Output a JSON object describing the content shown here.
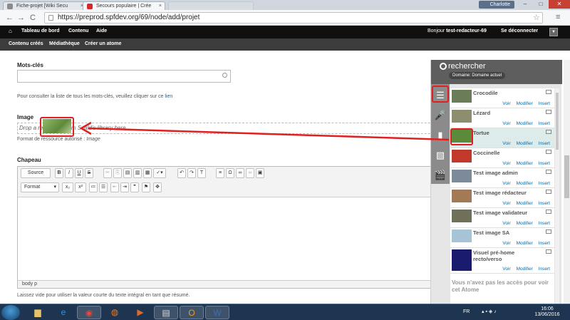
{
  "browser": {
    "tabs": [
      {
        "title": "Fiche-projet [Wiki Secu",
        "active": false
      },
      {
        "title": "Secours populaire | Crée",
        "active": true
      },
      {
        "title": "",
        "active": false
      }
    ],
    "user": "Charlotte",
    "url": "https://preprod.spfdev.org/69/node/add/projet"
  },
  "toolbar": {
    "home_icon": "home-icon",
    "items": [
      "Tableau de bord",
      "Contenu",
      "Aide"
    ],
    "greeting": "Bonjour",
    "username": "test-redacteur-69",
    "logout": "Se déconnecter",
    "secondary": [
      "Contenu créés",
      "Médiathèque",
      "Créer un atome"
    ]
  },
  "form": {
    "keywords_label": "Mots-clés",
    "keywords_help": "Pour consulter la liste de tous les mots-clés, veuillez cliquer sur ce",
    "keywords_link": "lien",
    "image_label": "Image",
    "image_dropzone": "Drop a ressource from Scald's library here.",
    "image_format_prefix": "Format de ressource autorisé :",
    "image_format": "Image",
    "chapeau_label": "Chapeau",
    "chapeau_help": "Laissez vide pour utiliser la valeur courte du texte intégral en tant que résumé.",
    "editor_source": "Source",
    "editor_format": "Format",
    "editor_path": "body  p"
  },
  "panel": {
    "search_label": "rechercher",
    "domain": "Domaine: Domaine actuel",
    "actions": [
      "Voir",
      "Modifier",
      "Insert"
    ],
    "items": [
      {
        "title": "Crocodile",
        "color": "#6b7d58"
      },
      {
        "title": "Lézard",
        "color": "#8d8d70"
      },
      {
        "title": "Tortue",
        "color": "#5a8a3a"
      },
      {
        "title": "Coccinelle",
        "color": "#c0392b"
      },
      {
        "title": "Test image admin",
        "color": "#7d8a9a"
      },
      {
        "title": "Test image rédacteur",
        "color": "#a27a55"
      },
      {
        "title": "Test image validateur",
        "color": "#6f6f5a"
      },
      {
        "title": "Test image SA",
        "color": "#a7c3d6"
      },
      {
        "title": "Visuel pré-home recto/verso",
        "color": "#1a1a6e"
      }
    ],
    "no_access": "Vous n'avez pas les accès pour voir cet Atome"
  },
  "taskbar": {
    "lang": "FR",
    "time": "16:06",
    "date": "13/06/2016"
  }
}
